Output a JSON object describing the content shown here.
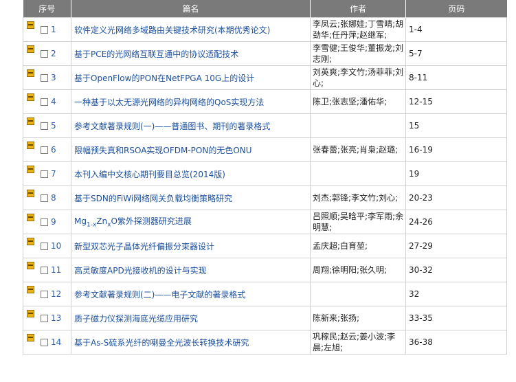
{
  "header": {
    "no": "序号",
    "title": "篇名",
    "author": "作者",
    "pages": "页码"
  },
  "rows": [
    {
      "no": "1",
      "title": "软件定义光网络多域路由关键技术研究(本期优秀论文)",
      "author": "李凤云;张娜娃;丁雪晴;胡劲华;任丹萍;赵继军;",
      "pages": "1-4"
    },
    {
      "no": "2",
      "title": "基于PCE的光网络互联互通中的协议适配技术",
      "author": "李雪健;王俊华;董振龙;刘志刚;",
      "pages": "5-7"
    },
    {
      "no": "3",
      "title": "基于OpenFlow的PON在NetFPGA 10G上的设计",
      "author": "刘英爽;李文竹;汤菲菲;刘心;",
      "pages": "8-11"
    },
    {
      "no": "4",
      "title": "一种基于以太无源光网络的异构网络的QoS实现方法",
      "author": "陈卫;张志坚;潘佑华;",
      "pages": "12-15"
    },
    {
      "no": "5",
      "title": "参考文献著录规则(一)——普通图书、期刊的著录格式",
      "author": "",
      "pages": "15"
    },
    {
      "no": "6",
      "title": "限幅预失真和RSOA实现OFDM-PON的无色ONU",
      "author": "张春蕾;张亮;肖枭;赵璐;",
      "pages": "16-19"
    },
    {
      "no": "7",
      "title": "本刊入编中文核心期刊要目总览(2014版)",
      "author": "",
      "pages": "19"
    },
    {
      "no": "8",
      "title": "基于SDN的FiWi网络网关负载均衡策略研究",
      "author": "刘杰;郭锋;李文竹;刘心;",
      "pages": "20-23"
    },
    {
      "no": "9",
      "title": "紫外探测器研究进展",
      "author": "吕照顺;吴晗平;李军雨;余明慧;",
      "pages": "24-26"
    },
    {
      "no": "10",
      "title": "新型双芯光子晶体光纤偏振分束器设计",
      "author": "孟庆超;白育堃;",
      "pages": "27-29"
    },
    {
      "no": "11",
      "title": "高灵敏度APD光接收机的设计与实现",
      "author": "周翔;徐明阳;张久明;",
      "pages": "30-32"
    },
    {
      "no": "12",
      "title": "参考文献著录规则(二)——电子文献的著录格式",
      "author": "",
      "pages": "32"
    },
    {
      "no": "13",
      "title": "质子磁力仪探测海底光缆应用研究",
      "author": "陈新来;张扬;",
      "pages": "33-35"
    },
    {
      "no": "14",
      "title": "基于As-S硫系光纤的喇曼全光波长转换技术研究",
      "author": "巩稼民;赵云;姜小波;李晨;左旭;",
      "pages": "36-38"
    }
  ],
  "formula9": {
    "a": "Mg",
    "s1": "1-x",
    "b": "Zn",
    "s2": "x",
    "c": "O"
  },
  "colors": {
    "header_bg": "#7a7a7a",
    "link": "#1b4f9c",
    "book_icon": "#e9b316"
  }
}
